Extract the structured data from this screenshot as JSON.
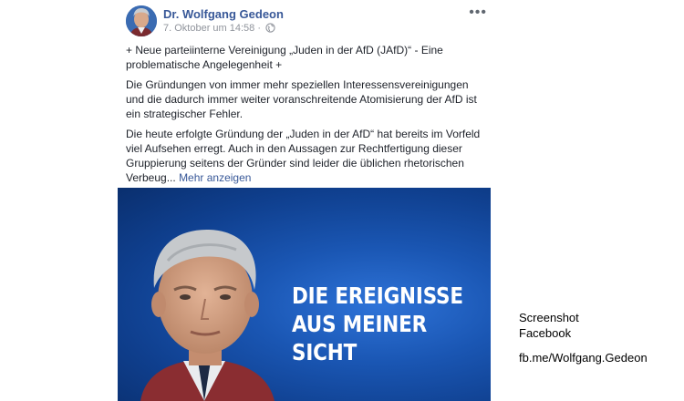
{
  "post": {
    "author": "Dr. Wolfgang Gedeon",
    "timestamp": "7. Oktober um 14:58",
    "separator": "·",
    "visibility_icon": "globe-icon",
    "menu_icon": "more-options-icon",
    "menu_glyph": "•••",
    "paragraphs": [
      "+ Neue parteiinterne Vereinigung „Juden in der AfD (JAfD)“ - Eine problematische Angelegenheit +",
      "Die Gründungen von immer mehr speziellen Interessensvereinigungen und die dadurch immer weiter voranschreitende Atomisierung der AfD ist ein strategischer Fehler.",
      "Die heute erfolgte Gründung der „Juden in der AfD“ hat bereits im Vorfeld viel Aufsehen erregt. Auch in den Aussagen zur Rechtfertigung dieser Gruppierung seitens der Gründer sind leider die üblichen rhetorischen Verbeug..."
    ],
    "see_more": "Mehr anzeigen",
    "image": {
      "headline_lines": [
        "DIE EREIGNISSE",
        "AUS MEINER",
        "SICHT"
      ]
    }
  },
  "caption": {
    "line1": "Screenshot",
    "line2": "Facebook",
    "source": "fb.me/Wolfgang.Gedeon"
  },
  "colors": {
    "link": "#385898",
    "text": "#1d2129",
    "meta": "#90949c",
    "image_blue": "#1a56b3"
  }
}
